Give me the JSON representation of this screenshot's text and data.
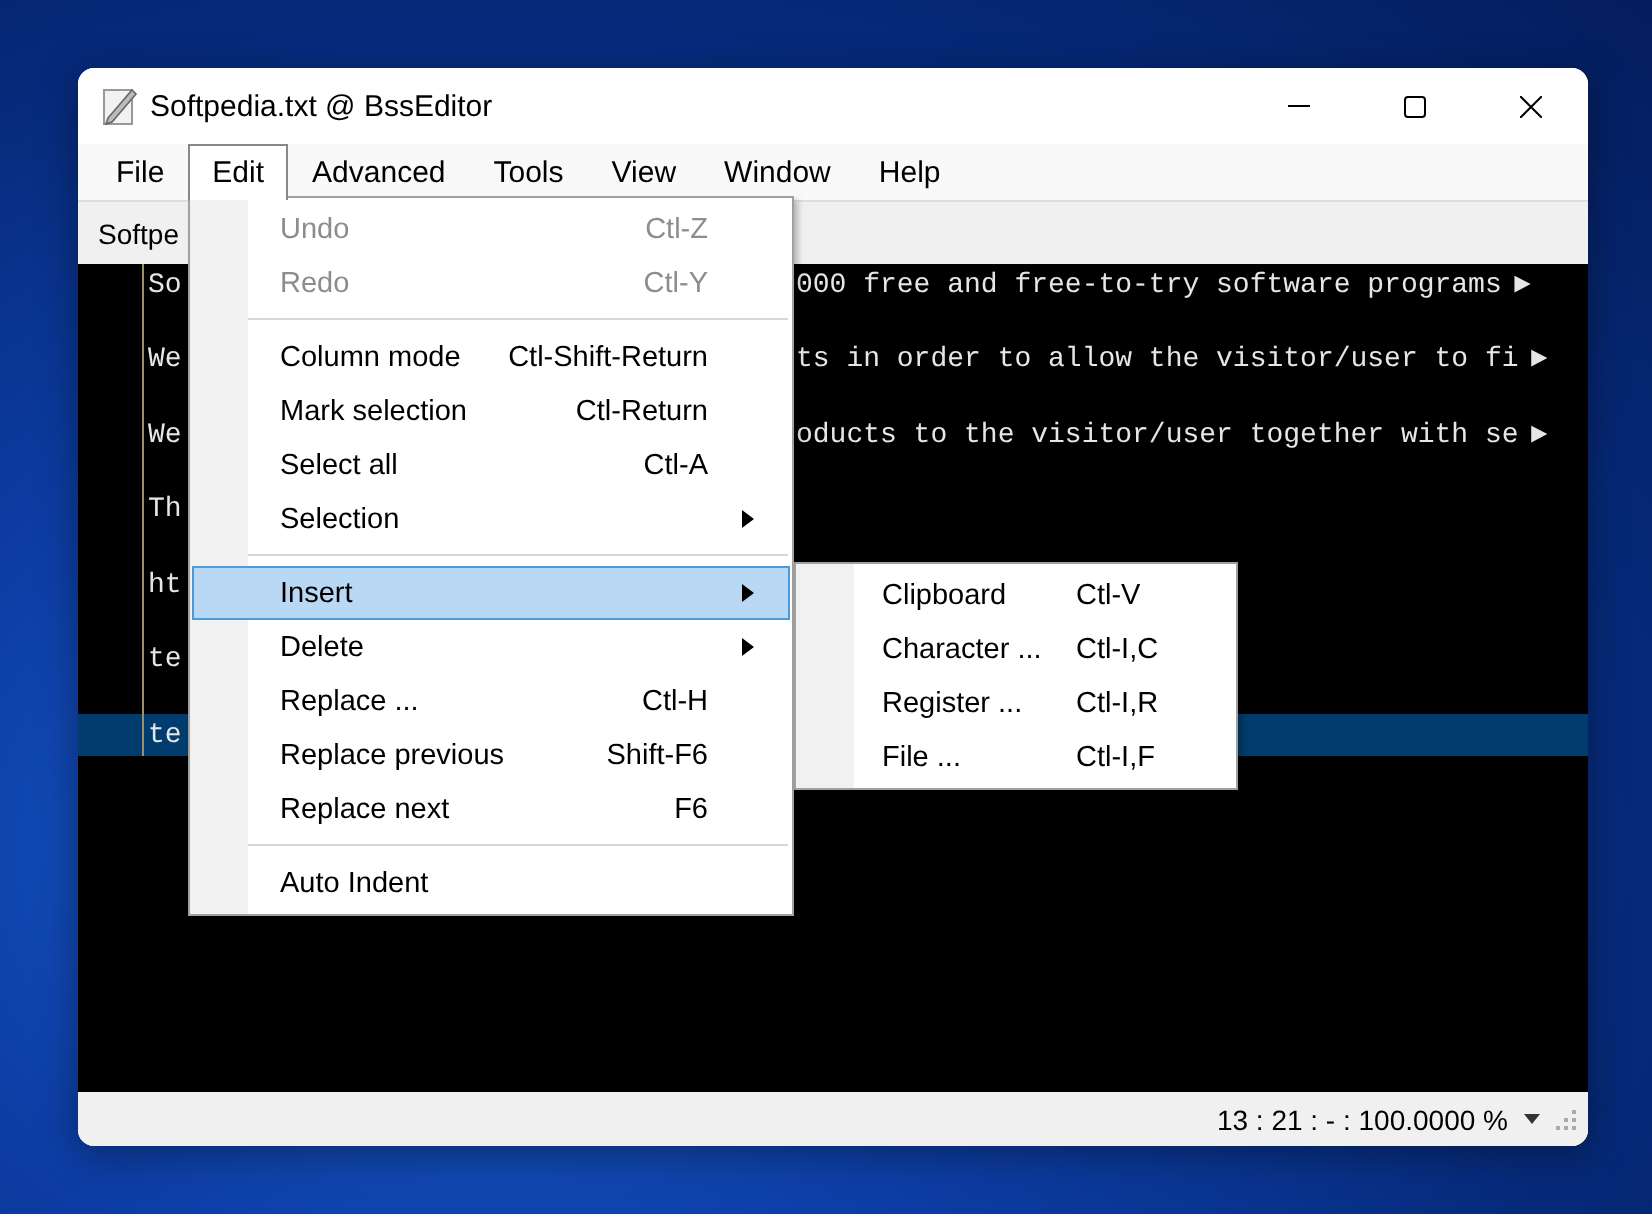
{
  "window": {
    "title": "Softpedia.txt @ BssEditor"
  },
  "menu_bar": [
    {
      "label": "File",
      "selected": false
    },
    {
      "label": "Edit",
      "selected": true
    },
    {
      "label": "Advanced",
      "selected": false
    },
    {
      "label": "Tools",
      "selected": false
    },
    {
      "label": "View",
      "selected": false
    },
    {
      "label": "Window",
      "selected": false
    },
    {
      "label": "Help",
      "selected": false
    }
  ],
  "tab": {
    "label": "Softpe"
  },
  "editor": {
    "lines": [
      {
        "left": "So",
        "right": "000 free and free-to-try software programs",
        "overflow": "►",
        "selected": false
      },
      {
        "left": "We",
        "right": "ts in order to allow the visitor/user to fi",
        "overflow": "►",
        "selected": false
      },
      {
        "left": "We",
        "right": "oducts to the visitor/user together with se",
        "overflow": "►",
        "selected": false
      },
      {
        "left": "Th",
        "selected": false
      },
      {
        "left": "ht",
        "selected": false
      },
      {
        "left": "te",
        "selected": false
      },
      {
        "left": "te",
        "selected": true
      }
    ]
  },
  "edit_menu": [
    {
      "kind": "item",
      "label": "Undo",
      "shortcut": "Ctl-Z",
      "disabled": true,
      "selected": false,
      "submenu": false
    },
    {
      "kind": "item",
      "label": "Redo",
      "shortcut": "Ctl-Y",
      "disabled": true,
      "selected": false,
      "submenu": false
    },
    {
      "kind": "separator"
    },
    {
      "kind": "item",
      "label": "Column mode",
      "shortcut": "Ctl-Shift-Return",
      "disabled": false,
      "selected": false,
      "submenu": false
    },
    {
      "kind": "item",
      "label": "Mark selection",
      "shortcut": "Ctl-Return",
      "disabled": false,
      "selected": false,
      "submenu": false
    },
    {
      "kind": "item",
      "label": "Select all",
      "shortcut": "Ctl-A",
      "disabled": false,
      "selected": false,
      "submenu": false
    },
    {
      "kind": "item",
      "label": "Selection",
      "disabled": false,
      "selected": false,
      "submenu": true
    },
    {
      "kind": "separator"
    },
    {
      "kind": "item",
      "label": "Insert",
      "disabled": false,
      "selected": true,
      "submenu": true
    },
    {
      "kind": "item",
      "label": "Delete",
      "disabled": false,
      "selected": false,
      "submenu": true
    },
    {
      "kind": "item",
      "label": "Replace ...",
      "shortcut": "Ctl-H",
      "disabled": false,
      "selected": false,
      "submenu": false
    },
    {
      "kind": "item",
      "label": "Replace previous",
      "shortcut": "Shift-F6",
      "disabled": false,
      "selected": false,
      "submenu": false
    },
    {
      "kind": "item",
      "label": "Replace next",
      "shortcut": "F6",
      "disabled": false,
      "selected": false,
      "submenu": false
    },
    {
      "kind": "separator"
    },
    {
      "kind": "item",
      "label": "Auto Indent",
      "disabled": false,
      "selected": false,
      "submenu": false
    }
  ],
  "insert_submenu": [
    {
      "label": "Clipboard",
      "shortcut": "Ctl-V"
    },
    {
      "label": "Character ...",
      "shortcut": "Ctl-I,C"
    },
    {
      "label": "Register ...",
      "shortcut": "Ctl-I,R"
    },
    {
      "label": "File ...",
      "shortcut": "Ctl-I,F"
    }
  ],
  "status_bar": {
    "text": "13 : 21 : - : 100.0000  %"
  }
}
